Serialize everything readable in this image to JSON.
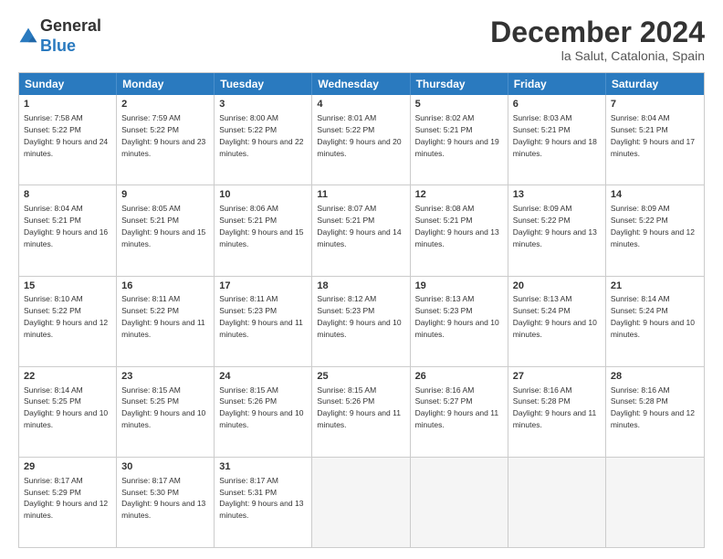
{
  "header": {
    "logo_general": "General",
    "logo_blue": "Blue",
    "month_title": "December 2024",
    "location": "la Salut, Catalonia, Spain"
  },
  "weekdays": [
    "Sunday",
    "Monday",
    "Tuesday",
    "Wednesday",
    "Thursday",
    "Friday",
    "Saturday"
  ],
  "rows": [
    [
      {
        "day": "1",
        "sunrise": "7:58 AM",
        "sunset": "5:22 PM",
        "daylight": "9 hours and 24 minutes."
      },
      {
        "day": "2",
        "sunrise": "7:59 AM",
        "sunset": "5:22 PM",
        "daylight": "9 hours and 23 minutes."
      },
      {
        "day": "3",
        "sunrise": "8:00 AM",
        "sunset": "5:22 PM",
        "daylight": "9 hours and 22 minutes."
      },
      {
        "day": "4",
        "sunrise": "8:01 AM",
        "sunset": "5:22 PM",
        "daylight": "9 hours and 20 minutes."
      },
      {
        "day": "5",
        "sunrise": "8:02 AM",
        "sunset": "5:21 PM",
        "daylight": "9 hours and 19 minutes."
      },
      {
        "day": "6",
        "sunrise": "8:03 AM",
        "sunset": "5:21 PM",
        "daylight": "9 hours and 18 minutes."
      },
      {
        "day": "7",
        "sunrise": "8:04 AM",
        "sunset": "5:21 PM",
        "daylight": "9 hours and 17 minutes."
      }
    ],
    [
      {
        "day": "8",
        "sunrise": "8:04 AM",
        "sunset": "5:21 PM",
        "daylight": "9 hours and 16 minutes."
      },
      {
        "day": "9",
        "sunrise": "8:05 AM",
        "sunset": "5:21 PM",
        "daylight": "9 hours and 15 minutes."
      },
      {
        "day": "10",
        "sunrise": "8:06 AM",
        "sunset": "5:21 PM",
        "daylight": "9 hours and 15 minutes."
      },
      {
        "day": "11",
        "sunrise": "8:07 AM",
        "sunset": "5:21 PM",
        "daylight": "9 hours and 14 minutes."
      },
      {
        "day": "12",
        "sunrise": "8:08 AM",
        "sunset": "5:21 PM",
        "daylight": "9 hours and 13 minutes."
      },
      {
        "day": "13",
        "sunrise": "8:09 AM",
        "sunset": "5:22 PM",
        "daylight": "9 hours and 13 minutes."
      },
      {
        "day": "14",
        "sunrise": "8:09 AM",
        "sunset": "5:22 PM",
        "daylight": "9 hours and 12 minutes."
      }
    ],
    [
      {
        "day": "15",
        "sunrise": "8:10 AM",
        "sunset": "5:22 PM",
        "daylight": "9 hours and 12 minutes."
      },
      {
        "day": "16",
        "sunrise": "8:11 AM",
        "sunset": "5:22 PM",
        "daylight": "9 hours and 11 minutes."
      },
      {
        "day": "17",
        "sunrise": "8:11 AM",
        "sunset": "5:23 PM",
        "daylight": "9 hours and 11 minutes."
      },
      {
        "day": "18",
        "sunrise": "8:12 AM",
        "sunset": "5:23 PM",
        "daylight": "9 hours and 10 minutes."
      },
      {
        "day": "19",
        "sunrise": "8:13 AM",
        "sunset": "5:23 PM",
        "daylight": "9 hours and 10 minutes."
      },
      {
        "day": "20",
        "sunrise": "8:13 AM",
        "sunset": "5:24 PM",
        "daylight": "9 hours and 10 minutes."
      },
      {
        "day": "21",
        "sunrise": "8:14 AM",
        "sunset": "5:24 PM",
        "daylight": "9 hours and 10 minutes."
      }
    ],
    [
      {
        "day": "22",
        "sunrise": "8:14 AM",
        "sunset": "5:25 PM",
        "daylight": "9 hours and 10 minutes."
      },
      {
        "day": "23",
        "sunrise": "8:15 AM",
        "sunset": "5:25 PM",
        "daylight": "9 hours and 10 minutes."
      },
      {
        "day": "24",
        "sunrise": "8:15 AM",
        "sunset": "5:26 PM",
        "daylight": "9 hours and 10 minutes."
      },
      {
        "day": "25",
        "sunrise": "8:15 AM",
        "sunset": "5:26 PM",
        "daylight": "9 hours and 11 minutes."
      },
      {
        "day": "26",
        "sunrise": "8:16 AM",
        "sunset": "5:27 PM",
        "daylight": "9 hours and 11 minutes."
      },
      {
        "day": "27",
        "sunrise": "8:16 AM",
        "sunset": "5:28 PM",
        "daylight": "9 hours and 11 minutes."
      },
      {
        "day": "28",
        "sunrise": "8:16 AM",
        "sunset": "5:28 PM",
        "daylight": "9 hours and 12 minutes."
      }
    ],
    [
      {
        "day": "29",
        "sunrise": "8:17 AM",
        "sunset": "5:29 PM",
        "daylight": "9 hours and 12 minutes."
      },
      {
        "day": "30",
        "sunrise": "8:17 AM",
        "sunset": "5:30 PM",
        "daylight": "9 hours and 13 minutes."
      },
      {
        "day": "31",
        "sunrise": "8:17 AM",
        "sunset": "5:31 PM",
        "daylight": "9 hours and 13 minutes."
      },
      null,
      null,
      null,
      null
    ]
  ]
}
